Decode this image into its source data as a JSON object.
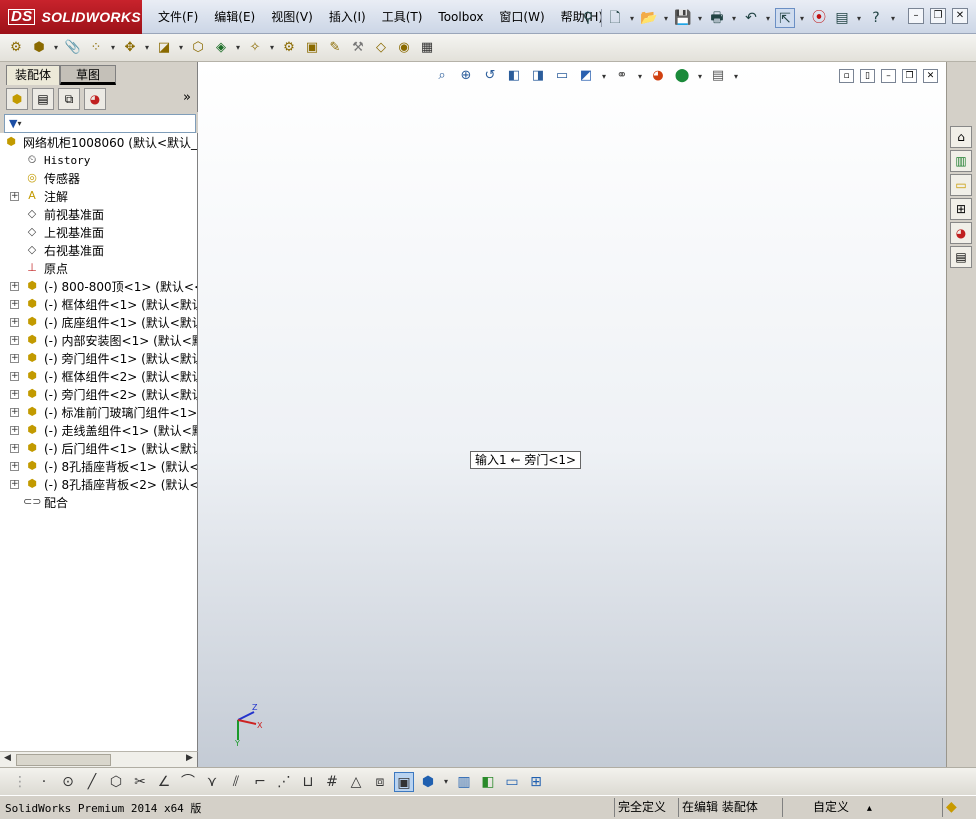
{
  "app": {
    "brand_prefix": "DS",
    "brand": "SOLIDWORKS"
  },
  "menu": [
    "文件(F)",
    "编辑(E)",
    "视图(V)",
    "插入(I)",
    "工具(T)",
    "Toolbox",
    "窗口(W)",
    "帮助(H)"
  ],
  "feature_manager": {
    "tabs": [
      "装配体",
      "草图"
    ],
    "tree": [
      {
        "label": "网络机柜1008060  (默认<默认_5",
        "icon": "assembly-icon",
        "expander": "",
        "indent": 0
      },
      {
        "label": "History",
        "icon": "history-icon",
        "expander": "",
        "indent": 1,
        "mono": true
      },
      {
        "label": "传感器",
        "icon": "sensor-icon",
        "expander": "",
        "indent": 1
      },
      {
        "label": "注解",
        "icon": "annotation-icon",
        "expander": "+",
        "indent": 1
      },
      {
        "label": "前视基准面",
        "icon": "plane-icon",
        "expander": "",
        "indent": 1
      },
      {
        "label": "上视基准面",
        "icon": "plane-icon",
        "expander": "",
        "indent": 1
      },
      {
        "label": "右视基准面",
        "icon": "plane-icon",
        "expander": "",
        "indent": 1
      },
      {
        "label": "原点",
        "icon": "origin-icon",
        "expander": "",
        "indent": 1
      },
      {
        "label": "(-) 800-800顶<1> (默认<<默",
        "icon": "component-icon",
        "expander": "+",
        "indent": 1
      },
      {
        "label": "(-) 框体组件<1> (默认<默认",
        "icon": "component-icon",
        "expander": "+",
        "indent": 1
      },
      {
        "label": "(-) 底座组件<1> (默认<默认",
        "icon": "component-icon",
        "expander": "+",
        "indent": 1
      },
      {
        "label": "(-) 内部安装图<1> (默认<默",
        "icon": "component-icon",
        "expander": "+",
        "indent": 1
      },
      {
        "label": "(-) 旁门组件<1> (默认<默认",
        "icon": "component-icon",
        "expander": "+",
        "indent": 1
      },
      {
        "label": "(-) 框体组件<2> (默认<默认",
        "icon": "component-icon",
        "expander": "+",
        "indent": 1
      },
      {
        "label": "(-) 旁门组件<2> (默认<默认",
        "icon": "component-icon",
        "expander": "+",
        "indent": 1
      },
      {
        "label": "(-) 标准前门玻璃门组件<1>",
        "icon": "component-icon",
        "expander": "+",
        "indent": 1
      },
      {
        "label": "(-) 走线盖组件<1> (默认<默",
        "icon": "component-icon",
        "expander": "+",
        "indent": 1
      },
      {
        "label": "(-) 后门组件<1> (默认<默认",
        "icon": "component-icon",
        "expander": "+",
        "indent": 1
      },
      {
        "label": "(-) 8孔插座背板<1> (默认<",
        "icon": "component-icon",
        "expander": "+",
        "indent": 1
      },
      {
        "label": "(-) 8孔插座背板<2> (默认<",
        "icon": "component-icon",
        "expander": "+",
        "indent": 1
      },
      {
        "label": "配合",
        "icon": "mates-icon",
        "expander": "",
        "indent": 1
      }
    ]
  },
  "viewport": {
    "tag": "输入1 ← 旁门<1>",
    "triad": {
      "x": "X",
      "y": "Y",
      "z": "Z"
    }
  },
  "statusbar": {
    "product": "SolidWorks Premium 2014 x64 版",
    "definition": "完全定义",
    "mode": "在编辑 装配体",
    "custom": "自定义",
    "custom_arrow": "▴"
  },
  "colors": {
    "logo_red": "#b01c24",
    "selection_orange": "#f08a1e",
    "door_panel": "#c3b9c1",
    "cabinet_line": "#2a2a2a"
  }
}
